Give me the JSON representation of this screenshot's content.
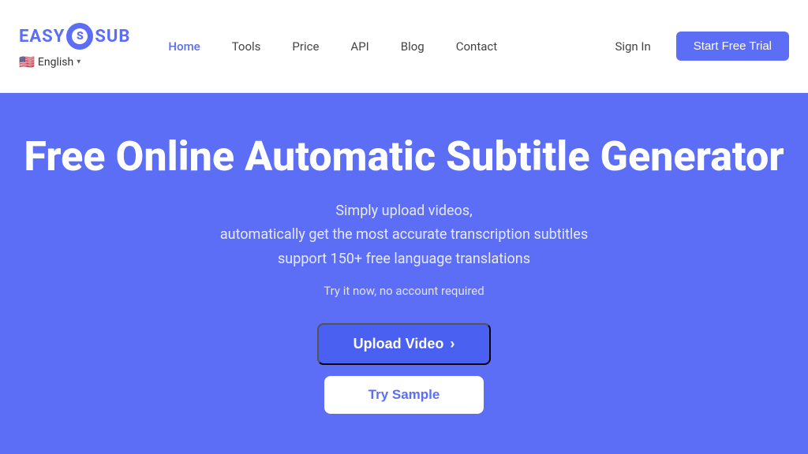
{
  "navbar": {
    "logo": {
      "easy": "EASY",
      "sub": "SUB"
    },
    "lang": {
      "flag": "🇺🇸",
      "label": "English"
    },
    "nav_links": [
      {
        "label": "Home",
        "active": true
      },
      {
        "label": "Tools",
        "active": false
      },
      {
        "label": "Price",
        "active": false
      },
      {
        "label": "API",
        "active": false
      },
      {
        "label": "Blog",
        "active": false
      },
      {
        "label": "Contact",
        "active": false
      }
    ],
    "sign_in": "Sign In",
    "trial_btn": "Start Free Trial"
  },
  "hero": {
    "title": "Free Online Automatic Subtitle Generator",
    "subtitle_line1": "Simply upload videos,",
    "subtitle_line2": "automatically get the most accurate transcription subtitles",
    "subtitle_line3": "support 150+ free language translations",
    "note": "Try it now, no account required",
    "upload_btn": "Upload Video",
    "upload_arrow": "›",
    "try_sample_btn": "Try Sample"
  }
}
